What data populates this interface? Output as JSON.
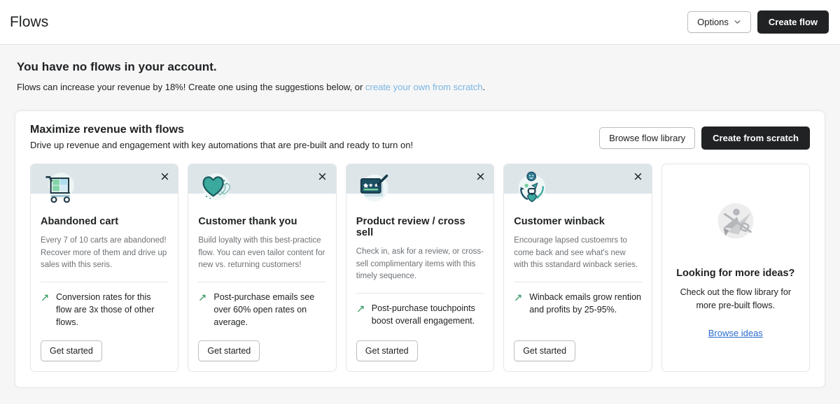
{
  "header": {
    "title": "Flows",
    "options_label": "Options",
    "options_icon": "chevron-down-icon",
    "create_flow_label": "Create flow"
  },
  "empty_state": {
    "heading": "You have no flows in your account.",
    "body_prefix": "Flows can increase your revenue by 18%! Create one using the suggestions below, or ",
    "link_text": "create your own from scratch",
    "body_suffix": "."
  },
  "panel": {
    "title": "Maximize revenue with flows",
    "subtitle": "Drive up revenue and engagement with key automations that are pre-built and ready to turn on!",
    "browse_label": "Browse flow library",
    "create_label": "Create from scratch"
  },
  "colors": {
    "band": "#dde5e9",
    "primary_button": "#202223",
    "trend_arrow": "#3fa06a",
    "link_light": "#7ab5e0",
    "link_blue": "#2c6ecb",
    "page_background": "#f6f6f7",
    "teal_dark": "#1b6b73",
    "teal": "#3ba99e",
    "navy": "#1d4f63"
  },
  "cards": [
    {
      "icon": "shopping-cart-icon",
      "title": "Abandoned cart",
      "description": "Every 7 of 10 carts are abandoned! Recover more of them and drive up sales with this seris.",
      "stat": "Conversion rates for this flow are 3x those of other flows.",
      "stat_icon": "trending-up-icon",
      "cta": "Get started",
      "close_icon": "close-icon"
    },
    {
      "icon": "heart-icon",
      "title": "Customer thank you",
      "description": "Build loyalty with this best-practice flow. You can even tailor content for new vs. returning customers!",
      "stat": "Post-purchase emails see over 60% open rates on average.",
      "stat_icon": "trending-up-icon",
      "cta": "Get started",
      "close_icon": "close-icon"
    },
    {
      "icon": "review-stars-icon",
      "title": "Product review / cross sell",
      "description": "Check in, ask for a review, or cross-sell complimentary items with this timely sequence.",
      "stat": "Post-purchase touchpoints boost overall engagement.",
      "stat_icon": "trending-up-icon",
      "cta": "Get started",
      "close_icon": "close-icon"
    },
    {
      "icon": "winback-cycle-icon",
      "title": "Customer winback",
      "description": "Encourage lapsed custoemrs to come back and see what's new with this sstandard winback series.",
      "stat": "Winback emails grow rention and profits by 25-95%.",
      "stat_icon": "trending-up-icon",
      "cta": "Get started",
      "close_icon": "close-icon"
    }
  ],
  "ideas_card": {
    "icon": "paper-plane-icon",
    "title": "Looking for more ideas?",
    "description": "Check out the flow library for more pre-built flows.",
    "link_text": "Browse ideas"
  }
}
